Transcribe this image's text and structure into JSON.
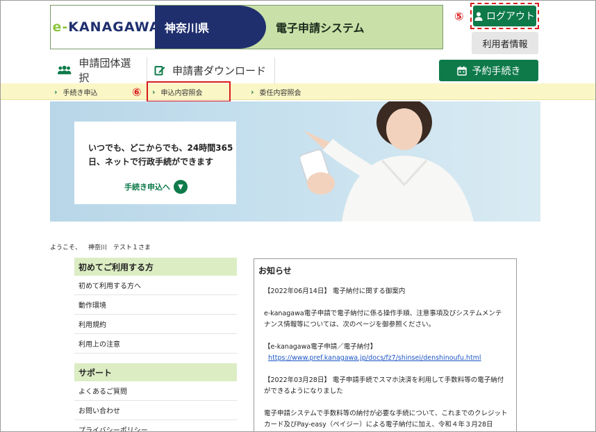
{
  "header": {
    "logo_prefix": "e-",
    "logo_main": "KANAGAWA",
    "prefecture": "神奈川県",
    "system_name": "電子申請システム",
    "logout_label": "ログアウト",
    "user_info_label": "利用者情報",
    "reserve_label": "予約手続き",
    "callout_logout": "⑤",
    "callout_inquiry": "⑥"
  },
  "nav": {
    "items": [
      {
        "label": "申請団体選択"
      },
      {
        "label": "申請書ダウンロード"
      }
    ]
  },
  "subnav": {
    "items": [
      {
        "label": "手続き申込"
      },
      {
        "label": "申込内容照会"
      },
      {
        "label": "委任内容照会"
      }
    ]
  },
  "hero": {
    "line1": "いつでも、どこからでも、24時間365",
    "line2": "日、ネットで行政手続ができます",
    "link_label": "手続き申込へ"
  },
  "welcome": {
    "prefix": "ようこそ、",
    "user_name": "神奈川　テスト１さま"
  },
  "sidebar": {
    "section1_title": "初めてご利用する方",
    "section1_items": [
      "初めて利用する方へ",
      "動作環境",
      "利用規約",
      "利用上の注意"
    ],
    "section2_title": "サポート",
    "section2_items": [
      "よくあるご質問",
      "お問い合わせ",
      "プライバシーポリシー"
    ]
  },
  "notice": {
    "title": "お知らせ",
    "items": [
      {
        "text": "【2022年06月14日】 電子納付に関する御案内"
      },
      {
        "text": "e-kanagawa電子申請で電子納付に係る操作手順、注意事項及びシステムメンテナンス情報等については、次のページを御参照ください。"
      },
      {
        "text": "【e-kanagawa電子申請／電子納付】",
        "link": "https://www.pref.kanagawa.jp/docs/fz7/shinsei/denshinoufu.html"
      },
      {
        "text": "【2022年03月28日】 電子申請手続でスマホ決済を利用して手数料等の電子納付ができるようになりました"
      },
      {
        "text": "電子申請システムで手数料等の納付が必要な手続について、これまでのクレジットカード及びPay-easy（ペイジー）による電子納付に加え、令和４年３月28日（月）からスマートフォンを利用した２次元バーコード決済、電子マネー決済やキャリア決済等による電子納付ができるようになりました。"
      }
    ]
  },
  "colors": {
    "brand_green": "#0e7a4a",
    "navy": "#1f2f6e",
    "banner_green": "#c9e0a8",
    "subnav_yellow": "#fbf6c6",
    "sidebar_head": "#dcedc4",
    "callout_red": "#d81b1b"
  }
}
